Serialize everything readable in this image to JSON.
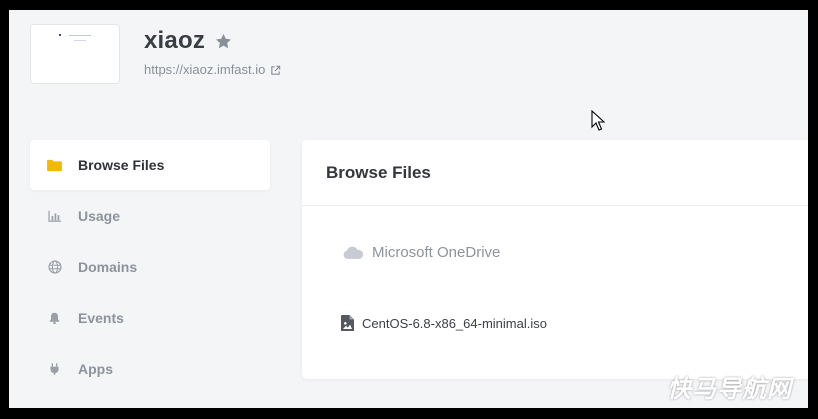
{
  "site": {
    "name": "xiaoz",
    "url": "https://xiaoz.imfast.io"
  },
  "sidebar": {
    "items": [
      {
        "label": "Browse Files",
        "icon": "folder-icon",
        "active": true
      },
      {
        "label": "Usage",
        "icon": "bar-chart-icon",
        "active": false
      },
      {
        "label": "Domains",
        "icon": "globe-icon",
        "active": false
      },
      {
        "label": "Events",
        "icon": "bell-icon",
        "active": false
      },
      {
        "label": "Apps",
        "icon": "plug-icon",
        "active": false
      }
    ]
  },
  "panel": {
    "title": "Browse Files",
    "storage_name": "Microsoft OneDrive",
    "files": [
      {
        "name": "CentOS-6.8-x86_64-minimal.iso",
        "icon": "image-file-icon"
      }
    ]
  },
  "watermark": "快马导航网",
  "colors": {
    "background": "#f4f5f7",
    "panel": "#ffffff",
    "folder_accent": "#f5b800",
    "muted_text": "#8d939c"
  }
}
